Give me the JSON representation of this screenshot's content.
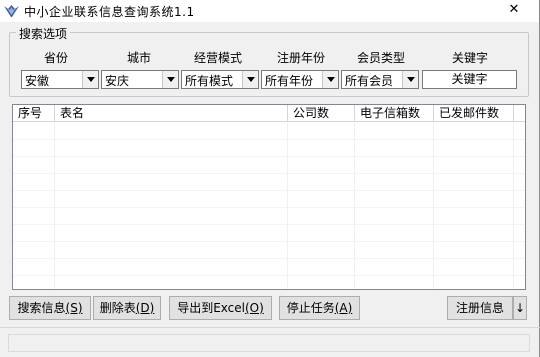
{
  "window": {
    "title": "中小企业联系信息查询系统1.1",
    "close_symbol": "✕"
  },
  "search_group": {
    "legend": "搜索选项",
    "labels": {
      "province": "省份",
      "city": "城市",
      "business_mode": "经营模式",
      "reg_year": "注册年份",
      "member_type": "会员类型",
      "keyword": "关键字"
    },
    "values": {
      "province": "安徽",
      "city": "安庆",
      "business_mode": "所有模式",
      "reg_year": "所有年份",
      "member_type": "所有会员",
      "keyword": "关键字"
    }
  },
  "table": {
    "columns": [
      "序号",
      "表名",
      "公司数",
      "电子信箱数",
      "已发邮件数"
    ],
    "rows": []
  },
  "buttons": {
    "search": {
      "label": "搜索信息",
      "hotkey": "(S)"
    },
    "delete_table": {
      "label": "删除表",
      "hotkey": "(D)"
    },
    "export_excel": {
      "label": "导出到Excel",
      "hotkey": "(O)"
    },
    "stop_task": {
      "label": "停止任务",
      "hotkey": "(A)"
    },
    "register": {
      "label": "注册信息"
    },
    "more": {
      "label": "↓"
    }
  },
  "colors": {
    "window_bg": "#f0f0f0",
    "button_bg": "#e1e1e1",
    "border": "#7a7a7a"
  }
}
